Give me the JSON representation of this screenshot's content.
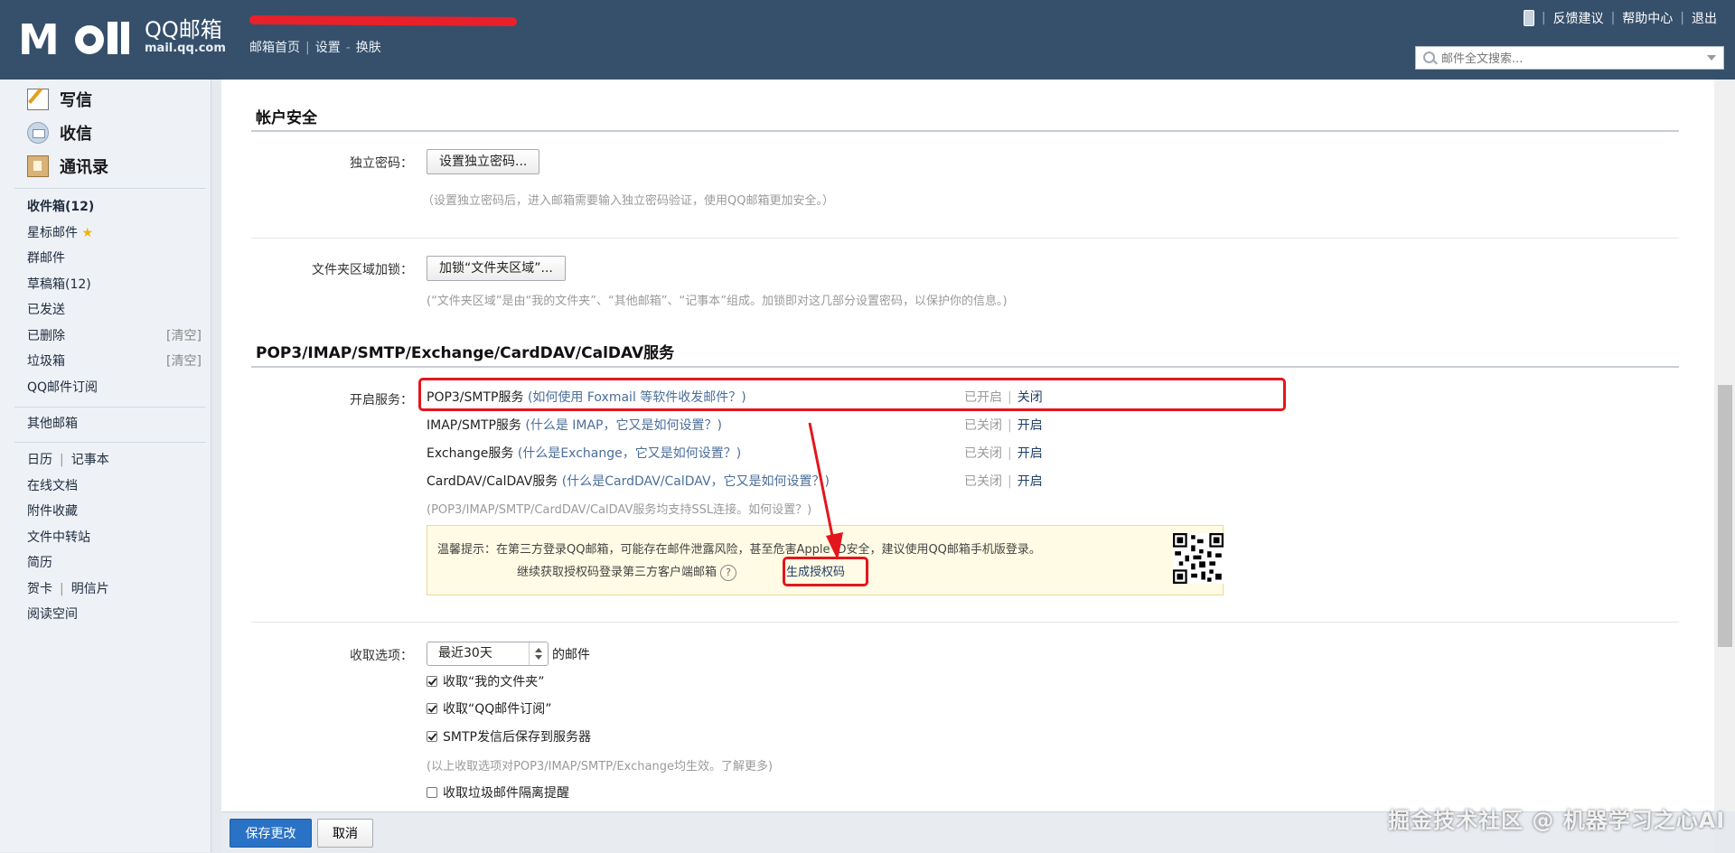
{
  "header": {
    "logo_brand": "QQ邮箱",
    "logo_sub": "mail.qq.com",
    "links": [
      "邮箱首页",
      "设置",
      "换肤"
    ],
    "top_links": [
      "反馈建议",
      "帮助中心",
      "退出"
    ],
    "search_placeholder": "邮件全文搜索..."
  },
  "sidebar": {
    "write": "写信",
    "inbox": "收信",
    "contacts": "通讯录",
    "folders": {
      "inbox": "收件箱(12)",
      "starred": "星标邮件",
      "group": "群邮件",
      "drafts": "草稿箱(12)",
      "sent": "已发送",
      "deleted": "已删除",
      "spam": "垃圾箱",
      "subscription": "QQ邮件订阅",
      "clear": "[清空]"
    },
    "other_mailbox": "其他邮箱",
    "tools": {
      "calendar": "日历",
      "notepad": "记事本",
      "online_docs": "在线文档",
      "attachments": "附件收藏",
      "file_transfer": "文件中转站",
      "resume": "简历",
      "greeting_card": "贺卡",
      "postcard": "明信片",
      "reading_space": "阅读空间"
    }
  },
  "account_security": {
    "title": "帐户安全",
    "independent_password": {
      "label": "独立密码：",
      "button": "设置独立密码...",
      "hint": "（设置独立密码后，进入邮箱需要输入独立密码验证，使用QQ邮箱更加安全。）"
    },
    "folder_lock": {
      "label": "文件夹区域加锁：",
      "button": "加锁“文件夹区域”...",
      "hint": "(“文件夹区域”是由“我的文件夹”、“其他邮箱”、“记事本”组成。加锁即对这几部分设置密码，以保护你的信息。)"
    }
  },
  "services": {
    "title": "POP3/IMAP/SMTP/Exchange/CardDAV/CalDAV服务",
    "label": "开启服务：",
    "items": [
      {
        "name": "POP3/SMTP服务",
        "question": "(如何使用 Foxmail 等软件收发邮件？)",
        "status": "已开启",
        "action": "关闭"
      },
      {
        "name": "IMAP/SMTP服务",
        "question": "(什么是 IMAP，它又是如何设置？)",
        "status": "已关闭",
        "action": "开启"
      },
      {
        "name": "Exchange服务",
        "question": "(什么是Exchange，它又是如何设置？)",
        "status": "已关闭",
        "action": "开启"
      },
      {
        "name": "CardDAV/CalDAV服务",
        "question": "(什么是CardDAV/CalDAV，它又是如何设置？)",
        "status": "已关闭",
        "action": "开启"
      }
    ],
    "ssl_hint": "(POP3/IMAP/SMTP/CardDAV/CalDAV服务均支持SSL连接。如何设置？)",
    "tip_line1": "温馨提示：在第三方登录QQ邮箱，可能存在邮件泄露风险，甚至危害Apple ID安全，建议使用QQ邮箱手机版登录。",
    "tip_line2": "继续获取授权码登录第三方客户端邮箱",
    "help_glyph": "?",
    "generate_code": "生成授权码"
  },
  "fetch_options": {
    "label": "收取选项：",
    "select_value": "最近30天",
    "select_suffix": "的邮件",
    "checks": [
      {
        "label": "收取“我的文件夹”",
        "checked": true
      },
      {
        "label": "收取“QQ邮件订阅”",
        "checked": true
      },
      {
        "label": "SMTP发信后保存到服务器",
        "checked": true
      }
    ],
    "hint": "(以上收取选项对POP3/IMAP/SMTP/Exchange均生效。了解更多)",
    "spam_check": {
      "label": "收取垃圾邮件隔离提醒",
      "checked": false
    }
  },
  "footer": {
    "save": "保存更改",
    "cancel": "取消"
  },
  "watermark": "掘金技术社区 @ 机器学习之心AI",
  "colors": {
    "header_bg": "#36506b",
    "highlight_red": "#e3161d",
    "primary_button": "#2a72c5"
  }
}
